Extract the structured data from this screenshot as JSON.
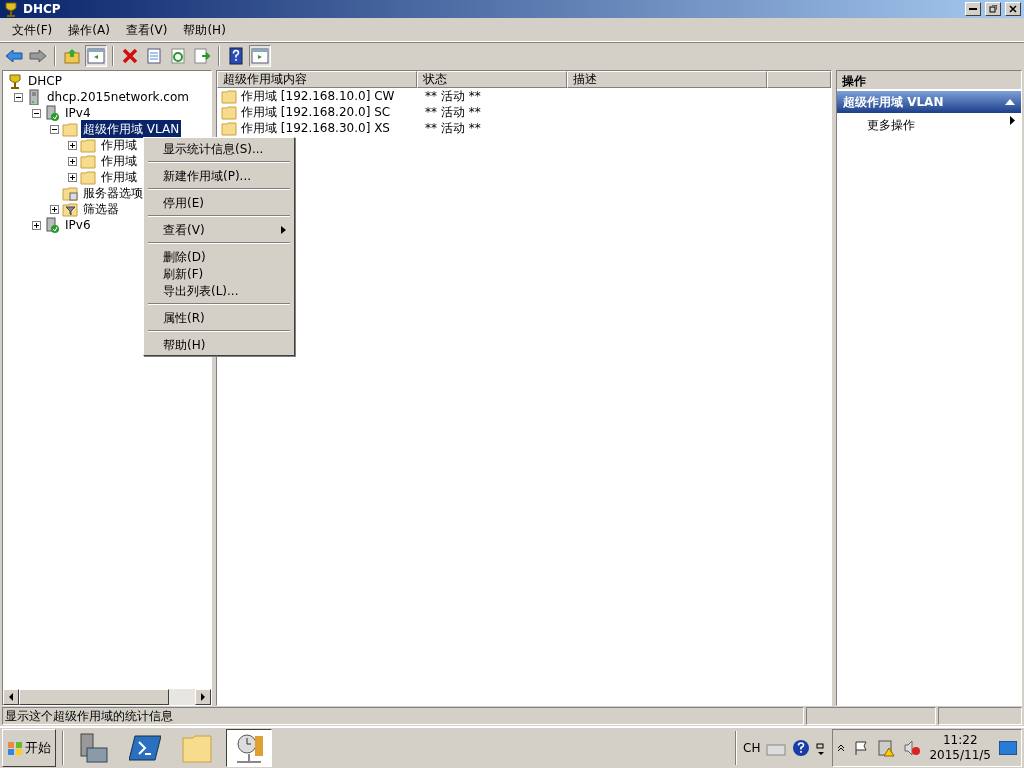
{
  "window": {
    "title": "DHCP"
  },
  "menu_bar": [
    "文件(F)",
    "操作(A)",
    "查看(V)",
    "帮助(H)"
  ],
  "toolbar": [
    {
      "kind": "back",
      "pressed": false
    },
    {
      "kind": "forward",
      "pressed": false
    },
    {
      "kind": "sep"
    },
    {
      "kind": "up",
      "pressed": false
    },
    {
      "kind": "tree",
      "pressed": true
    },
    {
      "kind": "sep"
    },
    {
      "kind": "delete",
      "pressed": false
    },
    {
      "kind": "properties",
      "pressed": false
    },
    {
      "kind": "refresh",
      "pressed": false
    },
    {
      "kind": "export",
      "pressed": false
    },
    {
      "kind": "sep"
    },
    {
      "kind": "help",
      "pressed": false
    },
    {
      "kind": "actionpane",
      "pressed": true
    }
  ],
  "tree": [
    {
      "label": "DHCP",
      "kind": "dhcp",
      "selected": false,
      "children": [
        {
          "label": "dhcp.2015network.com",
          "kind": "server",
          "expanded": true,
          "selected": false,
          "children": [
            {
              "label": "IPv4",
              "kind": "ip",
              "expanded": true,
              "selected": false,
              "children": [
                {
                  "label": "超级作用域 VLAN",
                  "kind": "folder",
                  "expanded": true,
                  "selected": true,
                  "children": [
                    {
                      "label": "作用域",
                      "kind": "folder",
                      "expanded": false,
                      "selected": false
                    },
                    {
                      "label": "作用域",
                      "kind": "folder",
                      "expanded": false,
                      "selected": false
                    },
                    {
                      "label": "作用域",
                      "kind": "folder",
                      "expanded": false,
                      "selected": false
                    }
                  ]
                },
                {
                  "label": "服务器选项",
                  "kind": "options",
                  "selected": false
                },
                {
                  "label": "筛选器",
                  "kind": "filter",
                  "expanded": false,
                  "selected": false
                }
              ]
            },
            {
              "label": "IPv6",
              "kind": "ip",
              "expanded": false,
              "selected": false
            }
          ]
        }
      ]
    }
  ],
  "list": {
    "columns": [
      "超级作用域内容",
      "状态",
      "描述"
    ],
    "rows": [
      [
        "作用域 [192.168.10.0] CW",
        "** 活动 **",
        ""
      ],
      [
        "作用域 [192.168.20.0] SC",
        "** 活动 **",
        ""
      ],
      [
        "作用域 [192.168.30.0] XS",
        "** 活动 **",
        ""
      ]
    ]
  },
  "actions": {
    "title": "操作",
    "section": "超级作用域 VLAN",
    "items": [
      {
        "label": "更多操作",
        "submenu": true
      }
    ]
  },
  "context_menu": [
    [
      {
        "label": "显示统计信息(S)...",
        "submenu": false
      }
    ],
    [
      {
        "label": "新建作用域(P)...",
        "submenu": false
      }
    ],
    [
      {
        "label": "停用(E)",
        "submenu": false
      }
    ],
    [
      {
        "label": "查看(V)",
        "submenu": true
      }
    ],
    [
      {
        "label": "删除(D)",
        "submenu": false
      },
      {
        "label": "刷新(F)",
        "submenu": false
      },
      {
        "label": "导出列表(L)...",
        "submenu": false
      }
    ],
    [
      {
        "label": "属性(R)",
        "submenu": false
      }
    ],
    [
      {
        "label": "帮助(H)",
        "submenu": false
      }
    ]
  ],
  "status_bar": "显示这个超级作用域的统计信息",
  "taskbar": {
    "start": "开始",
    "apps": [
      {
        "kind": "servermanager",
        "selected": false
      },
      {
        "kind": "powershell",
        "selected": false
      },
      {
        "kind": "explorer",
        "selected": false
      },
      {
        "kind": "dhcp",
        "selected": true
      }
    ],
    "language": "CH",
    "time": "11:22",
    "date": "2015/11/5"
  }
}
